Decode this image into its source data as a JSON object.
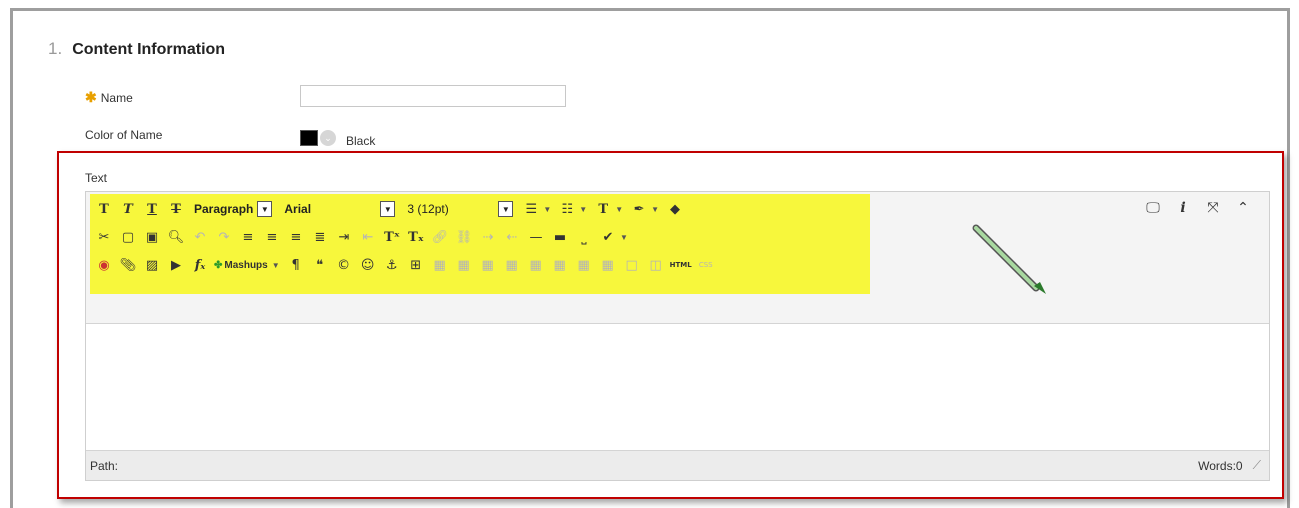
{
  "section": {
    "number": "1.",
    "title": "Content Information"
  },
  "fields": {
    "name_label": "Name",
    "name_value": "",
    "color_label": "Color of Name",
    "color_value": "Black",
    "color_swatch": "#000000",
    "text_label": "Text"
  },
  "toolbar": {
    "row1": {
      "format_block": "Paragraph",
      "font_family": "Arial",
      "font_size": "3 (12pt)"
    },
    "row3": {
      "mashups_label": "Mashups",
      "html_label": "HTML",
      "css_label": "CSS"
    }
  },
  "statusbar": {
    "path_label": "Path:",
    "word_count": "Words:0"
  },
  "colors": {
    "highlight_border": "#c00000",
    "toolbar_highlight": "#f7f73c"
  }
}
